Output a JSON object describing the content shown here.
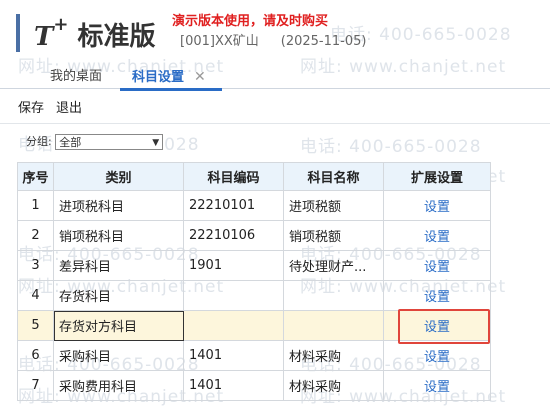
{
  "header": {
    "logo_mark": "T",
    "logo_plus": "+",
    "logo_text": "标准版",
    "demo_notice": "演示版本使用，请及时购买",
    "account": "[001]XX矿山",
    "date": "(2025-11-05)"
  },
  "tabs": [
    {
      "label": "我的桌面"
    },
    {
      "label": "科目设置"
    }
  ],
  "toolbar": {
    "save": "保存",
    "exit": "退出"
  },
  "filter": {
    "label": "分组:",
    "value": "全部"
  },
  "table": {
    "columns": [
      "序号",
      "类别",
      "科目编码",
      "科目名称",
      "扩展设置"
    ],
    "rows": [
      {
        "seq": "1",
        "category": "进项税科目",
        "code": "22210101",
        "name": "进项税额",
        "ext": "设置"
      },
      {
        "seq": "2",
        "category": "销项税科目",
        "code": "22210106",
        "name": "销项税额",
        "ext": "设置"
      },
      {
        "seq": "3",
        "category": "差异科目",
        "code": "1901",
        "name": "待处理财产...",
        "ext": "设置"
      },
      {
        "seq": "4",
        "category": "存货科目",
        "code": "",
        "name": "",
        "ext": "设置"
      },
      {
        "seq": "5",
        "category": "存货对方科目",
        "code": "",
        "name": "",
        "ext": "设置"
      },
      {
        "seq": "6",
        "category": "采购科目",
        "code": "1401",
        "name": "材料采购",
        "ext": "设置"
      },
      {
        "seq": "7",
        "category": "采购费用科目",
        "code": "1401",
        "name": "材料采购",
        "ext": "设置"
      }
    ]
  },
  "watermark": {
    "phone": "400-665-0028",
    "phone_label": "电话:",
    "site": "www.chanjet.net",
    "site_label": "网址:"
  },
  "colors": {
    "accent": "#2a6cc6",
    "notice": "#e02020",
    "highlight": "#e0453b",
    "header_bg": "#eaf3fb",
    "selected_row": "#fdf6dc"
  }
}
